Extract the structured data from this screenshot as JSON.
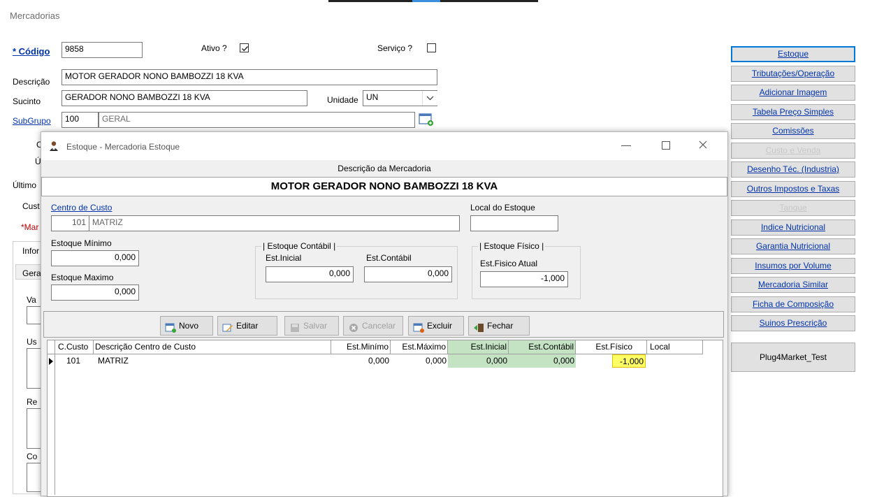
{
  "form": {
    "title": "Mercadorias",
    "codigo_label": "* Código",
    "codigo_value": "9858",
    "ativo_label": "Ativo ?",
    "ativo_checked": true,
    "servico_label": "Serviço ?",
    "servico_checked": false,
    "descricao_label": "Descrição",
    "descricao_value": "MOTOR GERADOR NONO BAMBOZZI 18 KVA",
    "sucinto_label": "Sucinto",
    "sucinto_value": "GERADOR NONO BAMBOZZI 18 KVA",
    "unidade_label": "Unidade",
    "unidade_value": "UN",
    "subgrupo_label": "SubGrupo",
    "subgrupo_code": "100",
    "subgrupo_name": "GERAL",
    "partial_labels": [
      "C",
      "Ú",
      "Último",
      "Cust",
      "*Mar",
      "Infor",
      "Gera",
      "Va",
      "Us",
      "Re",
      "Co"
    ]
  },
  "side_buttons": [
    {
      "label": "Estoque",
      "enabled": true
    },
    {
      "label": "Tributações/Operação",
      "enabled": true
    },
    {
      "label": "Adicionar Imagem",
      "enabled": true
    },
    {
      "label": "Tabela Preço Simples",
      "enabled": true
    },
    {
      "label": "Comissões",
      "enabled": true
    },
    {
      "label": "Custo e Venda",
      "enabled": false
    },
    {
      "label": "Desenho Téc. (Industria)",
      "enabled": true
    },
    {
      "label": "Outros Impostos e Taxas",
      "enabled": true
    },
    {
      "label": "Tanque",
      "enabled": false
    },
    {
      "label": "Indice Nutricional",
      "enabled": true
    },
    {
      "label": "Garantia Nutricional",
      "enabled": true
    },
    {
      "label": "Insumos por Volume",
      "enabled": true
    },
    {
      "label": "Mercadoria Similar",
      "enabled": true
    },
    {
      "label": "Ficha de Composição",
      "enabled": true
    },
    {
      "label": "Suinos Prescrição",
      "enabled": true
    }
  ],
  "plug_button": "Plug4Market_Test",
  "dialog": {
    "title": "Estoque - Mercadoria Estoque",
    "desc_header": "Descrição da Mercadoria",
    "desc_value": "MOTOR GERADOR NONO BAMBOZZI 18 KVA",
    "centro_custo_label": "Centro de Custo",
    "centro_custo_code": "101",
    "centro_custo_name": "MATRIZ",
    "local_estoque_label": "Local do Estoque",
    "local_estoque_value": "",
    "estoque_minimo_label": "Estoque Mínimo",
    "estoque_minimo_value": "0,000",
    "estoque_maximo_label": "Estoque Maximo",
    "estoque_maximo_value": "0,000",
    "contabil_group": "| Estoque Contábil |",
    "est_inicial_label": "Est.Inicial",
    "est_inicial_value": "0,000",
    "est_contabil_label": "Est.Contábil",
    "est_contabil_value": "0,000",
    "fisico_group": "| Estoque Físico |",
    "est_fisico_label": "Est.Fisico Atual",
    "est_fisico_value": "-1,000"
  },
  "toolbar": {
    "novo": "Novo",
    "editar": "Editar",
    "salvar": "Salvar",
    "cancelar": "Cancelar",
    "excluir": "Excluir",
    "fechar": "Fechar"
  },
  "grid": {
    "columns": [
      "C.Custo",
      "Descrição Centro de Custo",
      "Est.Minímo",
      "Est.Máximo",
      "Est.Inicial",
      "Est.Contábil",
      "Est.Físico",
      "Local"
    ],
    "rows": [
      [
        "101",
        "MATRIZ",
        "0,000",
        "0,000",
        "0,000",
        "0,000",
        "-1,000",
        ""
      ]
    ]
  }
}
